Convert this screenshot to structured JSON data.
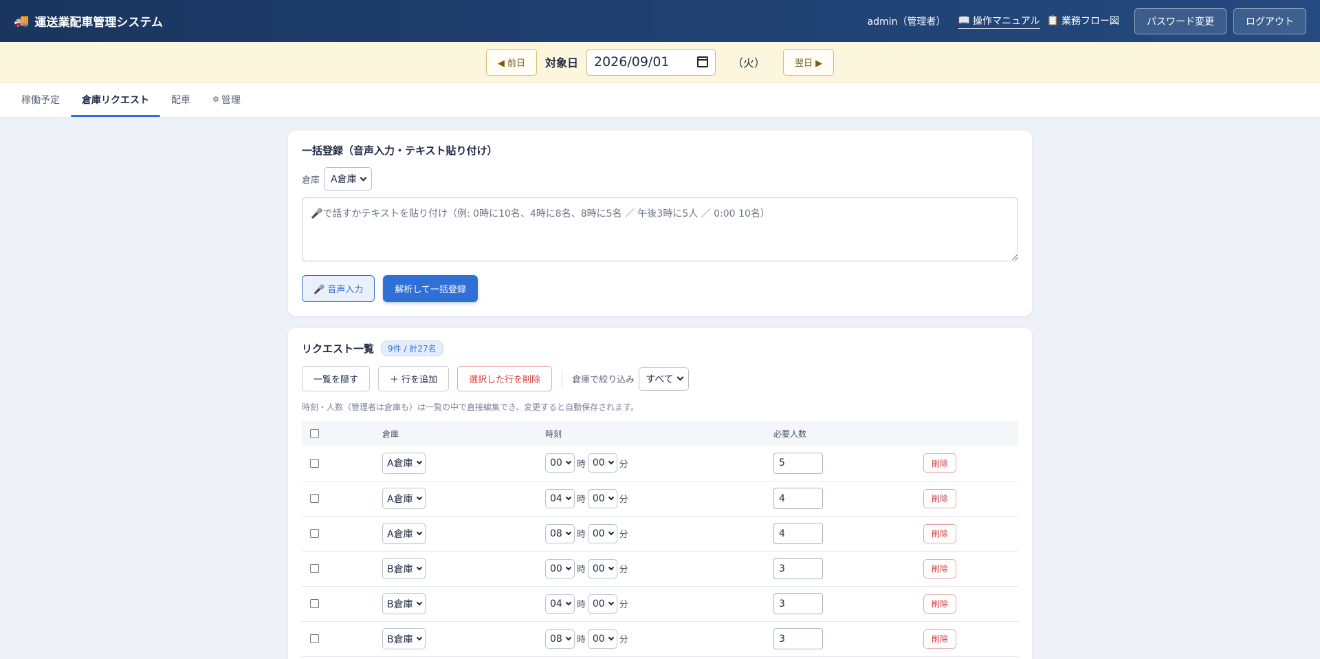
{
  "app": {
    "title": "運送業配車管理システム",
    "user": "admin（管理者）",
    "manual_link": "操作マニュアル",
    "flow_link": "業務フロー図",
    "password_button": "パスワード変更",
    "logout_button": "ログアウト"
  },
  "datebar": {
    "prev": "◀ 前日",
    "label": "対象日",
    "date": "2026/09/01",
    "weekday": "（火）",
    "next": "翌日 ▶"
  },
  "tabs": [
    "稼働予定",
    "倉庫リクエスト",
    "配車",
    "管理"
  ],
  "active_tab": "倉庫リクエスト",
  "bulk": {
    "title": "一括登録（音声入力・テキスト貼り付け）",
    "warehouse_label": "倉庫",
    "warehouse_value": "A倉庫",
    "placeholder": "🎤で話すかテキストを貼り付け（例: 0時に10名、4時に8名、8時に5名 ／ 午後3時に5人 ／ 0:00 10名）",
    "voice_button": "🎤 音声入力",
    "parse_button": "解析して一括登録"
  },
  "list": {
    "title": "リクエスト一覧",
    "badge": "9件 / 計27名",
    "hide_button": "一覧を隠す",
    "add_button": "＋ 行を追加",
    "delete_selected_button": "選択した行を削除",
    "filter_label": "倉庫で絞り込み",
    "filter_value": "すべて",
    "hint": "時刻・人数（管理者は倉庫も）は一覧の中で直接編集でき、変更すると自動保存されます。",
    "columns": {
      "warehouse": "倉庫",
      "time": "時刻",
      "required": "必要人数"
    },
    "hour_unit": "時",
    "minute_unit": "分",
    "delete_label": "削除",
    "rows": [
      {
        "warehouse": "A倉庫",
        "hour": "00",
        "minute": "00",
        "count": "5"
      },
      {
        "warehouse": "A倉庫",
        "hour": "04",
        "minute": "00",
        "count": "4"
      },
      {
        "warehouse": "A倉庫",
        "hour": "08",
        "minute": "00",
        "count": "4"
      },
      {
        "warehouse": "B倉庫",
        "hour": "00",
        "minute": "00",
        "count": "3"
      },
      {
        "warehouse": "B倉庫",
        "hour": "04",
        "minute": "00",
        "count": "3"
      },
      {
        "warehouse": "B倉庫",
        "hour": "08",
        "minute": "00",
        "count": "3"
      }
    ]
  }
}
